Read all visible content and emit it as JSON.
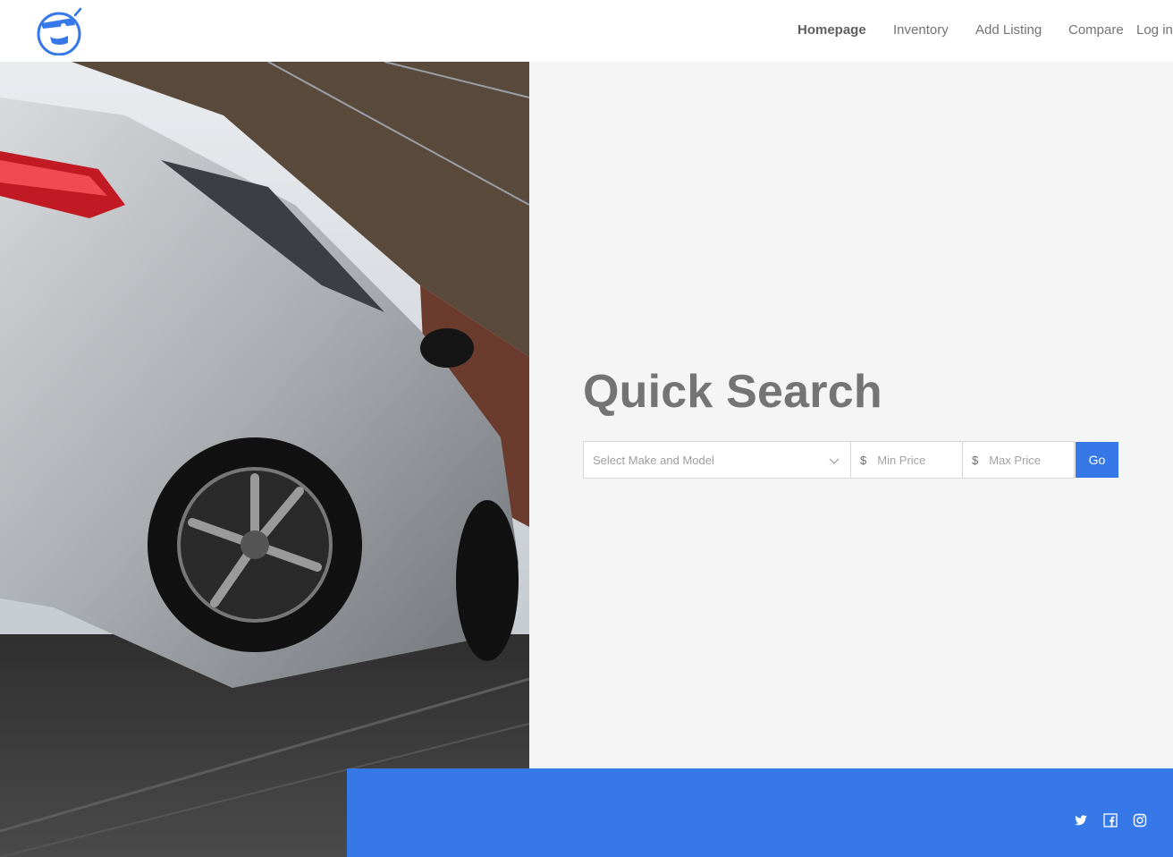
{
  "header": {
    "logo_icon": "smiley-logo-icon",
    "nav": [
      {
        "label": "Homepage",
        "active": true
      },
      {
        "label": "Inventory",
        "active": false
      },
      {
        "label": "Add Listing",
        "active": false
      },
      {
        "label": "Compare",
        "active": false
      },
      {
        "label": "Log in",
        "active": false
      }
    ]
  },
  "hero": {
    "image": "silver-car-photo"
  },
  "quick_search": {
    "title": "Quick Search",
    "make_model_placeholder": "Select Make and Model",
    "currency_symbol": "$",
    "min_price_placeholder": "Min Price",
    "max_price_placeholder": "Max Price",
    "go_label": "Go"
  },
  "footer": {
    "social": [
      "twitter-icon",
      "facebook-icon",
      "instagram-icon"
    ]
  },
  "colors": {
    "accent": "#3678e8",
    "background": "#f5f5f5",
    "text": "#737373"
  }
}
